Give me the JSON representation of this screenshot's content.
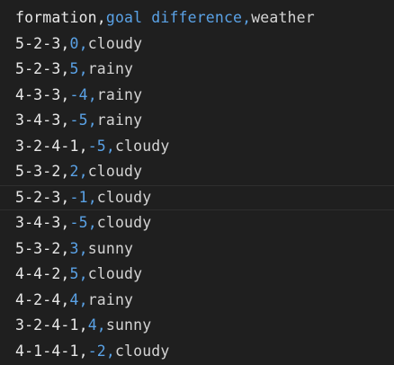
{
  "editor": {
    "lines": [
      {
        "c0": "formation",
        "c1": "goal difference",
        "c2": "weather"
      },
      {
        "c0": "5-2-3",
        "c1": "0",
        "c2": "cloudy"
      },
      {
        "c0": "5-2-3",
        "c1": "5",
        "c2": "rainy"
      },
      {
        "c0": "4-3-3",
        "c1": "-4",
        "c2": "rainy"
      },
      {
        "c0": "3-4-3",
        "c1": "-5",
        "c2": "rainy"
      },
      {
        "c0": "3-2-4-1",
        "c1": "-5",
        "c2": "cloudy"
      },
      {
        "c0": "5-3-2",
        "c1": "2",
        "c2": "cloudy"
      },
      {
        "c0": "5-2-3",
        "c1": "-1",
        "c2": "cloudy"
      },
      {
        "c0": "3-4-3",
        "c1": "-5",
        "c2": "cloudy"
      },
      {
        "c0": "5-3-2",
        "c1": "3",
        "c2": "sunny"
      },
      {
        "c0": "4-4-2",
        "c1": "5",
        "c2": "cloudy"
      },
      {
        "c0": "4-2-4",
        "c1": "4",
        "c2": "rainy"
      },
      {
        "c0": "3-2-4-1",
        "c1": "4",
        "c2": "sunny"
      },
      {
        "c0": "4-1-4-1",
        "c1": "-2",
        "c2": "cloudy"
      }
    ],
    "current_line": 7
  },
  "colors": {
    "background": "#1f1f1f",
    "column1": "#e8e8e8",
    "column2": "#5aa2e6",
    "column3": "#d4d4d4"
  }
}
